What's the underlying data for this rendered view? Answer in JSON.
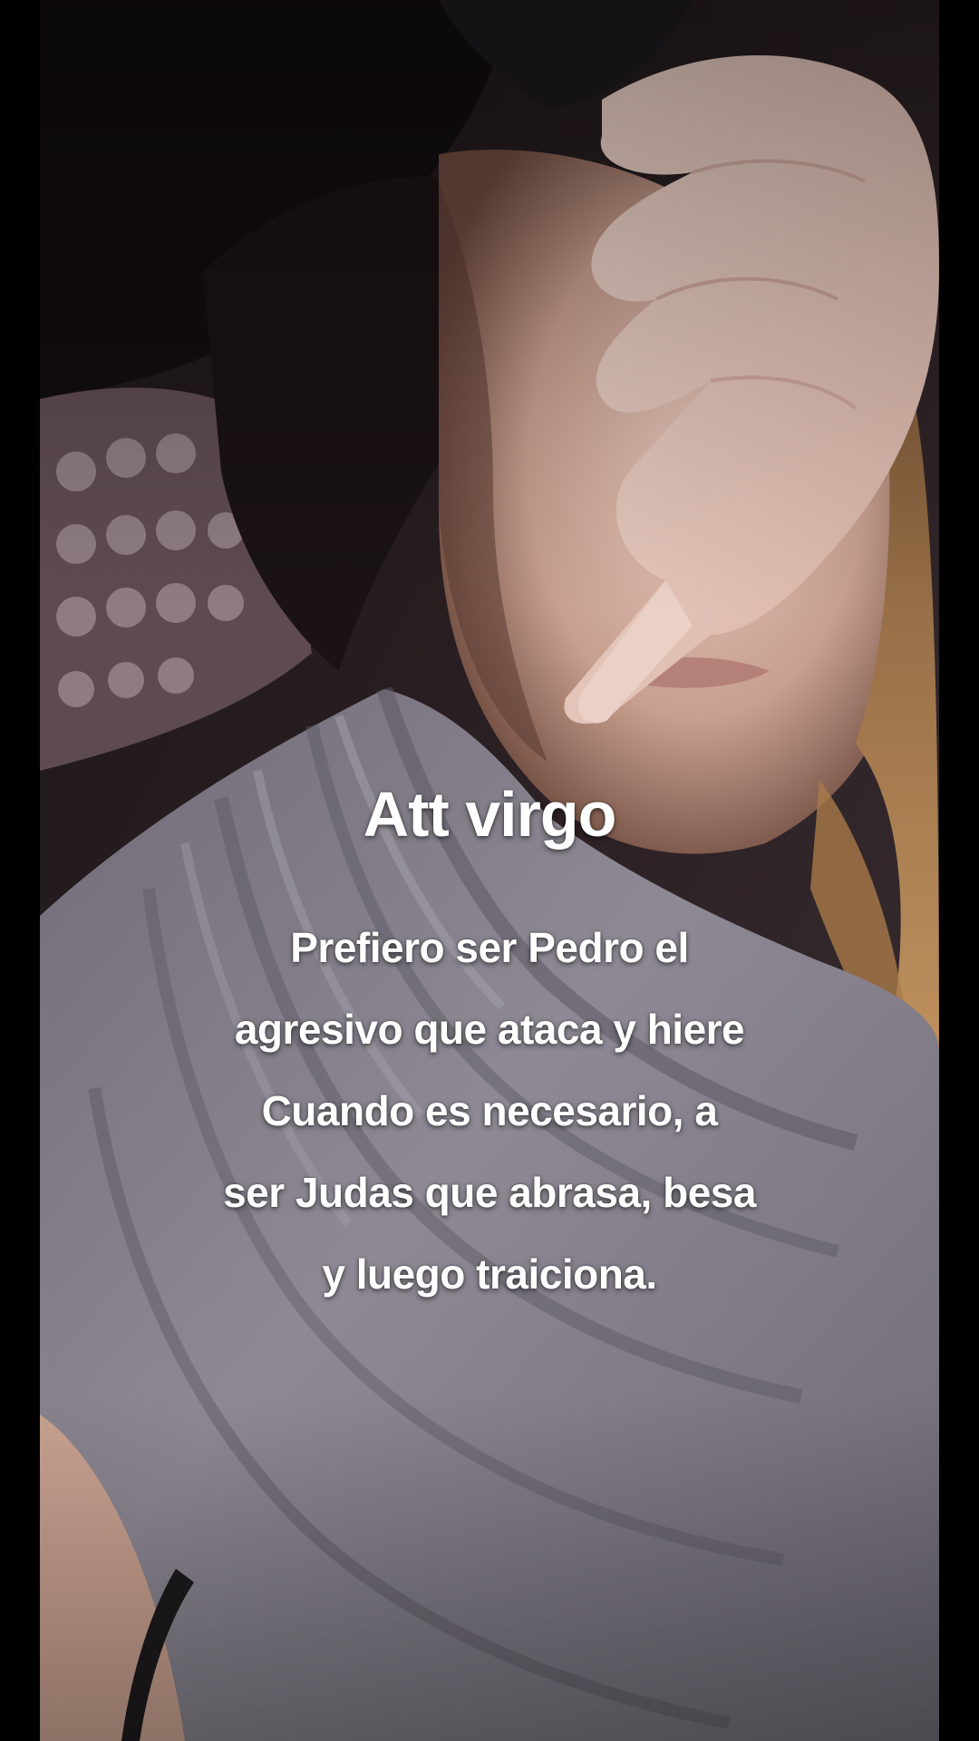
{
  "overlay": {
    "title": "Att virgo",
    "lines": [
      "Prefiero ser Pedro el",
      "agresivo que ataca y hiere",
      "Cuando es necesario, a",
      "ser Judas que abrasa, besa",
      "y luego traiciona."
    ]
  },
  "colors": {
    "sidebar": "#000000",
    "text": "#ffffff",
    "shirt": "#8a8590",
    "skin": "#d9b8a8",
    "hair": "#b8875c"
  }
}
